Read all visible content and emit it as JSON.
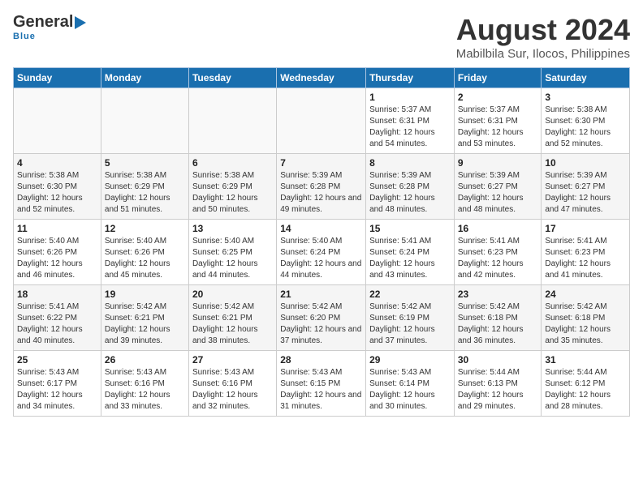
{
  "header": {
    "logo_general": "General",
    "logo_blue": "Blue",
    "month_year": "August 2024",
    "location": "Mabilbila Sur, Ilocos, Philippines"
  },
  "days_of_week": [
    "Sunday",
    "Monday",
    "Tuesday",
    "Wednesday",
    "Thursday",
    "Friday",
    "Saturday"
  ],
  "weeks": [
    [
      {
        "day": "",
        "sunrise": "",
        "sunset": "",
        "daylight": ""
      },
      {
        "day": "",
        "sunrise": "",
        "sunset": "",
        "daylight": ""
      },
      {
        "day": "",
        "sunrise": "",
        "sunset": "",
        "daylight": ""
      },
      {
        "day": "",
        "sunrise": "",
        "sunset": "",
        "daylight": ""
      },
      {
        "day": "1",
        "sunrise": "Sunrise: 5:37 AM",
        "sunset": "Sunset: 6:31 PM",
        "daylight": "Daylight: 12 hours and 54 minutes."
      },
      {
        "day": "2",
        "sunrise": "Sunrise: 5:37 AM",
        "sunset": "Sunset: 6:31 PM",
        "daylight": "Daylight: 12 hours and 53 minutes."
      },
      {
        "day": "3",
        "sunrise": "Sunrise: 5:38 AM",
        "sunset": "Sunset: 6:30 PM",
        "daylight": "Daylight: 12 hours and 52 minutes."
      }
    ],
    [
      {
        "day": "4",
        "sunrise": "Sunrise: 5:38 AM",
        "sunset": "Sunset: 6:30 PM",
        "daylight": "Daylight: 12 hours and 52 minutes."
      },
      {
        "day": "5",
        "sunrise": "Sunrise: 5:38 AM",
        "sunset": "Sunset: 6:29 PM",
        "daylight": "Daylight: 12 hours and 51 minutes."
      },
      {
        "day": "6",
        "sunrise": "Sunrise: 5:38 AM",
        "sunset": "Sunset: 6:29 PM",
        "daylight": "Daylight: 12 hours and 50 minutes."
      },
      {
        "day": "7",
        "sunrise": "Sunrise: 5:39 AM",
        "sunset": "Sunset: 6:28 PM",
        "daylight": "Daylight: 12 hours and 49 minutes."
      },
      {
        "day": "8",
        "sunrise": "Sunrise: 5:39 AM",
        "sunset": "Sunset: 6:28 PM",
        "daylight": "Daylight: 12 hours and 48 minutes."
      },
      {
        "day": "9",
        "sunrise": "Sunrise: 5:39 AM",
        "sunset": "Sunset: 6:27 PM",
        "daylight": "Daylight: 12 hours and 48 minutes."
      },
      {
        "day": "10",
        "sunrise": "Sunrise: 5:39 AM",
        "sunset": "Sunset: 6:27 PM",
        "daylight": "Daylight: 12 hours and 47 minutes."
      }
    ],
    [
      {
        "day": "11",
        "sunrise": "Sunrise: 5:40 AM",
        "sunset": "Sunset: 6:26 PM",
        "daylight": "Daylight: 12 hours and 46 minutes."
      },
      {
        "day": "12",
        "sunrise": "Sunrise: 5:40 AM",
        "sunset": "Sunset: 6:26 PM",
        "daylight": "Daylight: 12 hours and 45 minutes."
      },
      {
        "day": "13",
        "sunrise": "Sunrise: 5:40 AM",
        "sunset": "Sunset: 6:25 PM",
        "daylight": "Daylight: 12 hours and 44 minutes."
      },
      {
        "day": "14",
        "sunrise": "Sunrise: 5:40 AM",
        "sunset": "Sunset: 6:24 PM",
        "daylight": "Daylight: 12 hours and 44 minutes."
      },
      {
        "day": "15",
        "sunrise": "Sunrise: 5:41 AM",
        "sunset": "Sunset: 6:24 PM",
        "daylight": "Daylight: 12 hours and 43 minutes."
      },
      {
        "day": "16",
        "sunrise": "Sunrise: 5:41 AM",
        "sunset": "Sunset: 6:23 PM",
        "daylight": "Daylight: 12 hours and 42 minutes."
      },
      {
        "day": "17",
        "sunrise": "Sunrise: 5:41 AM",
        "sunset": "Sunset: 6:23 PM",
        "daylight": "Daylight: 12 hours and 41 minutes."
      }
    ],
    [
      {
        "day": "18",
        "sunrise": "Sunrise: 5:41 AM",
        "sunset": "Sunset: 6:22 PM",
        "daylight": "Daylight: 12 hours and 40 minutes."
      },
      {
        "day": "19",
        "sunrise": "Sunrise: 5:42 AM",
        "sunset": "Sunset: 6:21 PM",
        "daylight": "Daylight: 12 hours and 39 minutes."
      },
      {
        "day": "20",
        "sunrise": "Sunrise: 5:42 AM",
        "sunset": "Sunset: 6:21 PM",
        "daylight": "Daylight: 12 hours and 38 minutes."
      },
      {
        "day": "21",
        "sunrise": "Sunrise: 5:42 AM",
        "sunset": "Sunset: 6:20 PM",
        "daylight": "Daylight: 12 hours and 37 minutes."
      },
      {
        "day": "22",
        "sunrise": "Sunrise: 5:42 AM",
        "sunset": "Sunset: 6:19 PM",
        "daylight": "Daylight: 12 hours and 37 minutes."
      },
      {
        "day": "23",
        "sunrise": "Sunrise: 5:42 AM",
        "sunset": "Sunset: 6:18 PM",
        "daylight": "Daylight: 12 hours and 36 minutes."
      },
      {
        "day": "24",
        "sunrise": "Sunrise: 5:42 AM",
        "sunset": "Sunset: 6:18 PM",
        "daylight": "Daylight: 12 hours and 35 minutes."
      }
    ],
    [
      {
        "day": "25",
        "sunrise": "Sunrise: 5:43 AM",
        "sunset": "Sunset: 6:17 PM",
        "daylight": "Daylight: 12 hours and 34 minutes."
      },
      {
        "day": "26",
        "sunrise": "Sunrise: 5:43 AM",
        "sunset": "Sunset: 6:16 PM",
        "daylight": "Daylight: 12 hours and 33 minutes."
      },
      {
        "day": "27",
        "sunrise": "Sunrise: 5:43 AM",
        "sunset": "Sunset: 6:16 PM",
        "daylight": "Daylight: 12 hours and 32 minutes."
      },
      {
        "day": "28",
        "sunrise": "Sunrise: 5:43 AM",
        "sunset": "Sunset: 6:15 PM",
        "daylight": "Daylight: 12 hours and 31 minutes."
      },
      {
        "day": "29",
        "sunrise": "Sunrise: 5:43 AM",
        "sunset": "Sunset: 6:14 PM",
        "daylight": "Daylight: 12 hours and 30 minutes."
      },
      {
        "day": "30",
        "sunrise": "Sunrise: 5:44 AM",
        "sunset": "Sunset: 6:13 PM",
        "daylight": "Daylight: 12 hours and 29 minutes."
      },
      {
        "day": "31",
        "sunrise": "Sunrise: 5:44 AM",
        "sunset": "Sunset: 6:12 PM",
        "daylight": "Daylight: 12 hours and 28 minutes."
      }
    ]
  ]
}
